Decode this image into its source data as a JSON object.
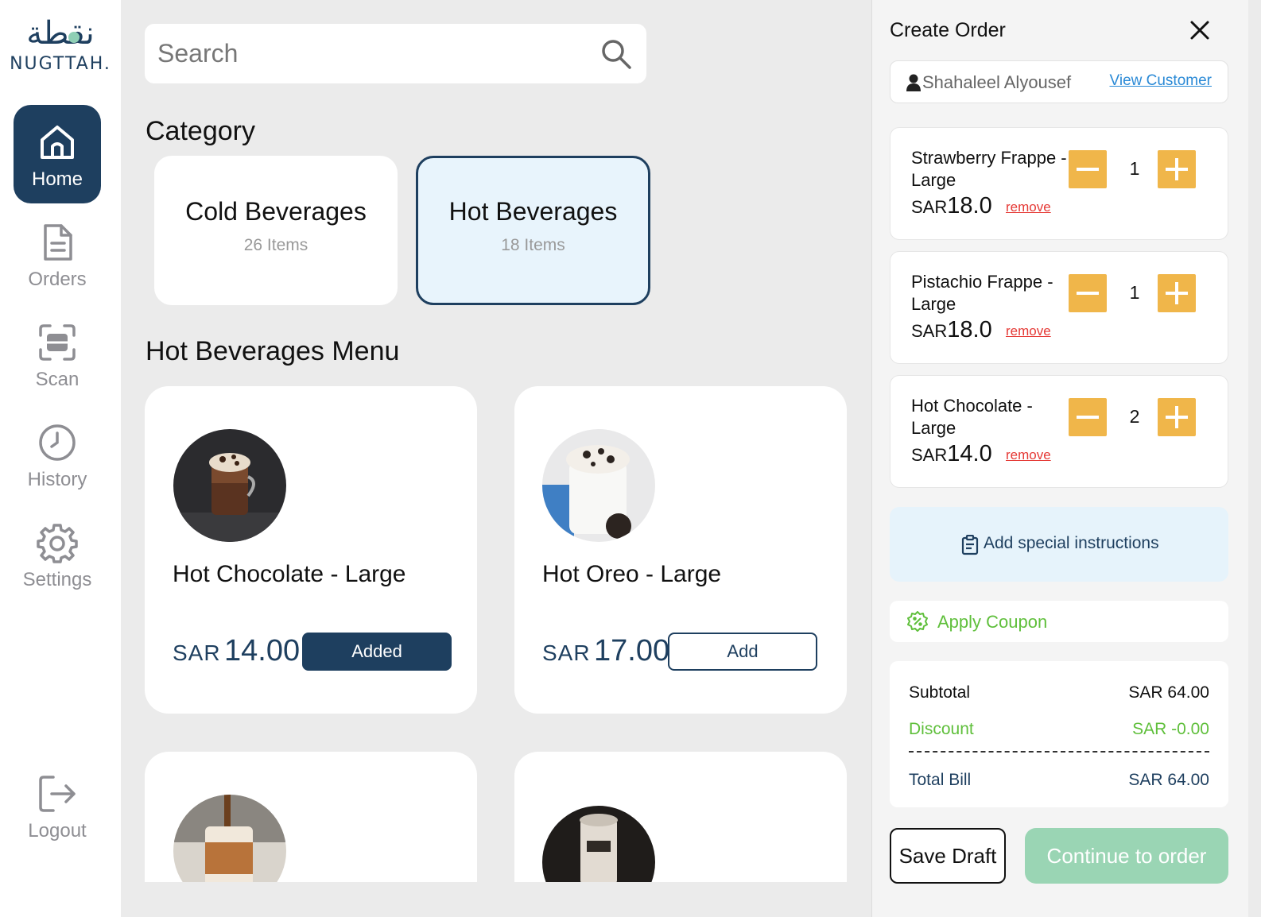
{
  "brand": {
    "arabic": "نقطة",
    "latin": "NUGTTAH."
  },
  "sidebar": {
    "items": [
      {
        "label": "Home",
        "icon": "home-icon",
        "active": true
      },
      {
        "label": "Orders",
        "icon": "document-icon",
        "active": false
      },
      {
        "label": "Scan",
        "icon": "scan-icon",
        "active": false
      },
      {
        "label": "History",
        "icon": "clock-icon",
        "active": false
      },
      {
        "label": "Settings",
        "icon": "gear-icon",
        "active": false
      }
    ],
    "logout_label": "Logout"
  },
  "search": {
    "placeholder": "Search"
  },
  "category": {
    "title": "Category",
    "items": [
      {
        "name": "Cold Beverages",
        "count": "26 Items",
        "selected": false
      },
      {
        "name": "Hot Beverages",
        "count": "18 Items",
        "selected": true
      }
    ]
  },
  "menu": {
    "title": "Hot Beverages Menu",
    "products": [
      {
        "name": "Hot Chocolate - Large",
        "currency": "SAR",
        "price": "14.00",
        "button": "Added",
        "state": "added"
      },
      {
        "name": "Hot Oreo - Large",
        "currency": "SAR",
        "price": "17.00",
        "button": "Add",
        "state": "add"
      }
    ]
  },
  "order": {
    "title": "Create Order",
    "customer": {
      "name": "Shahaleel Alyousef",
      "view_label": "View Customer"
    },
    "items": [
      {
        "name": "Strawberry Frappe - Large",
        "currency": "SAR",
        "price": "18.0",
        "qty": "1",
        "remove_label": "remove"
      },
      {
        "name": "Pistachio Frappe - Large",
        "currency": "SAR",
        "price": "18.0",
        "qty": "1",
        "remove_label": "remove"
      },
      {
        "name": "Hot Chocolate - Large",
        "currency": "SAR",
        "price": "14.0",
        "qty": "2",
        "remove_label": "remove"
      }
    ],
    "instructions_label": "Add special instructions",
    "coupon_label": "Apply Coupon",
    "summary": {
      "subtotal_label": "Subtotal",
      "subtotal_value": "SAR 64.00",
      "discount_label": "Discount",
      "discount_value": "SAR -0.00",
      "total_label": "Total Bill",
      "total_value": "SAR 64.00"
    },
    "save_draft_label": "Save Draft",
    "continue_label": "Continue to order"
  },
  "colors": {
    "primary": "#1e3f5f",
    "accent_orange": "#f0b64a",
    "success_green": "#5fbf3b",
    "continue_green": "#9ad5b4",
    "link_blue": "#2b8ad6",
    "danger_red": "#e53935"
  }
}
